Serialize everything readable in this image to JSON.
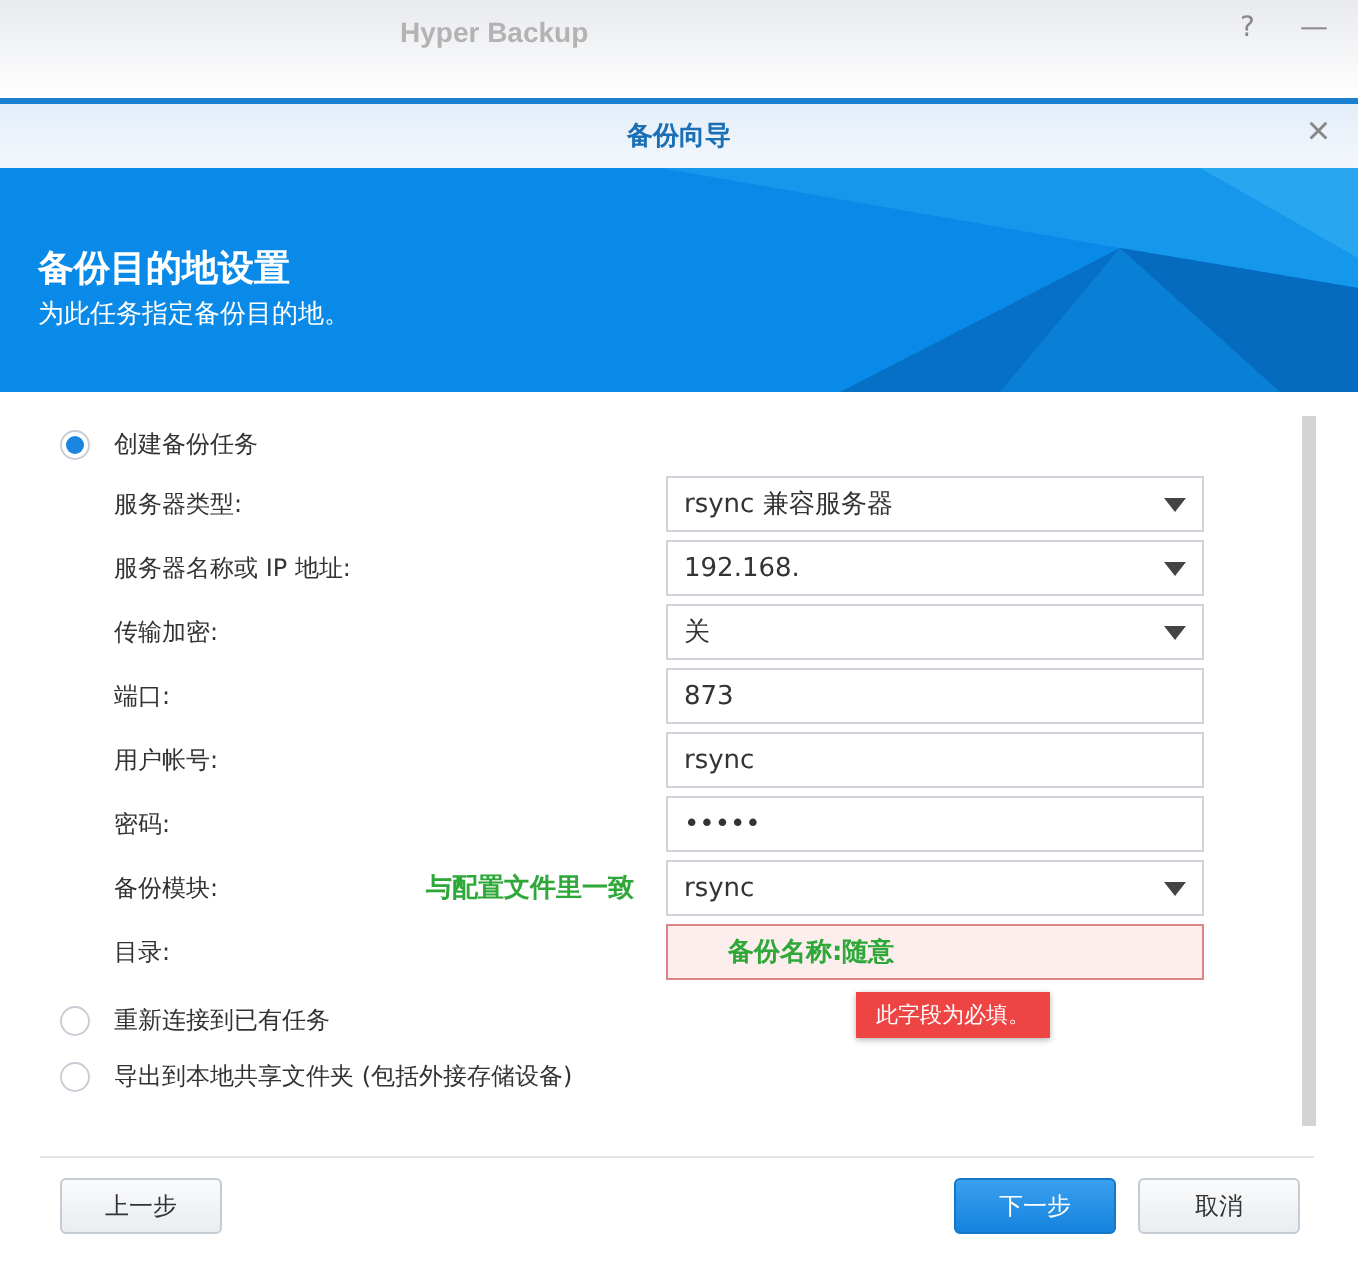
{
  "app_window": {
    "title": "Hyper Backup",
    "help": "?",
    "minimize": "—"
  },
  "dialog": {
    "title": "备份向导",
    "close": "×"
  },
  "banner": {
    "title": "备份目的地设置",
    "subtitle": "为此任务指定备份目的地。"
  },
  "options": [
    {
      "label": "创建备份任务",
      "selected": true
    },
    {
      "label": "重新连接到已有任务",
      "selected": false
    },
    {
      "label": "导出到本地共享文件夹 (包括外接存储设备)",
      "selected": false
    }
  ],
  "fields": [
    {
      "label": "服务器类型:",
      "kind": "dropdown",
      "value": "rsync 兼容服务器"
    },
    {
      "label": "服务器名称或 IP 地址:",
      "kind": "dropdown",
      "value": "192.168."
    },
    {
      "label": "传输加密:",
      "kind": "dropdown",
      "value": "关"
    },
    {
      "label": "端口:",
      "kind": "text",
      "value": "873"
    },
    {
      "label": "用户帐号:",
      "kind": "text",
      "value": "rsync"
    },
    {
      "label": "密码:",
      "kind": "password",
      "value": "•••••"
    },
    {
      "label": "备份模块:",
      "kind": "dropdown",
      "value": "rsync",
      "note": "与配置文件里一致"
    },
    {
      "label": "目录:",
      "kind": "text",
      "error": true,
      "note_inside": "备份名称:随意"
    }
  ],
  "error_tooltip": "此字段为必填。",
  "buttons": [
    {
      "label": "上一步",
      "kind": "secondary"
    },
    {
      "label": "下一步",
      "kind": "primary"
    },
    {
      "label": "取消",
      "kind": "secondary"
    }
  ]
}
